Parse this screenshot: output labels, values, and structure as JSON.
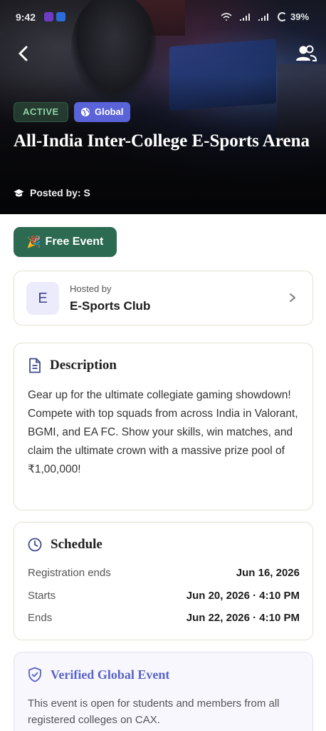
{
  "status_bar": {
    "time": "9:42",
    "battery": "39%"
  },
  "header": {
    "badge_status": "ACTIVE",
    "badge_scope": "Global",
    "title": "All-India Inter-College E-Sports Arena",
    "posted_by": "Posted by: S"
  },
  "price_badge": {
    "emoji": "🎉",
    "label": "Free Event"
  },
  "host": {
    "initial": "E",
    "sub_label": "Hosted by",
    "name": "E-Sports Club"
  },
  "description": {
    "heading": "Description",
    "body": "Gear up for the ultimate collegiate gaming showdown! Compete with top squads from across India in Valorant, BGMI, and EA FC. Show your skills, win matches, and claim the ultimate crown with a massive prize pool of ₹1,00,000!"
  },
  "schedule": {
    "heading": "Schedule",
    "rows": [
      {
        "label": "Registration ends",
        "value": "Jun 16, 2026"
      },
      {
        "label": "Starts",
        "value": "Jun 20, 2026 · 4:10 PM"
      },
      {
        "label": "Ends",
        "value": "Jun 22, 2026 · 4:10 PM"
      }
    ]
  },
  "verified": {
    "heading": "Verified Global Event",
    "body": "This event is open for students and members from all registered colleges on CAX."
  },
  "colors": {
    "primary_green": "#2c6a52",
    "accent_indigo": "#5b63d8",
    "active_text": "#8fd1a8"
  },
  "icons": [
    "back-arrow-icon",
    "people-icon",
    "globe-icon",
    "graduation-cap-icon",
    "chevron-right-icon",
    "document-icon",
    "clock-icon",
    "shield-check-icon"
  ]
}
